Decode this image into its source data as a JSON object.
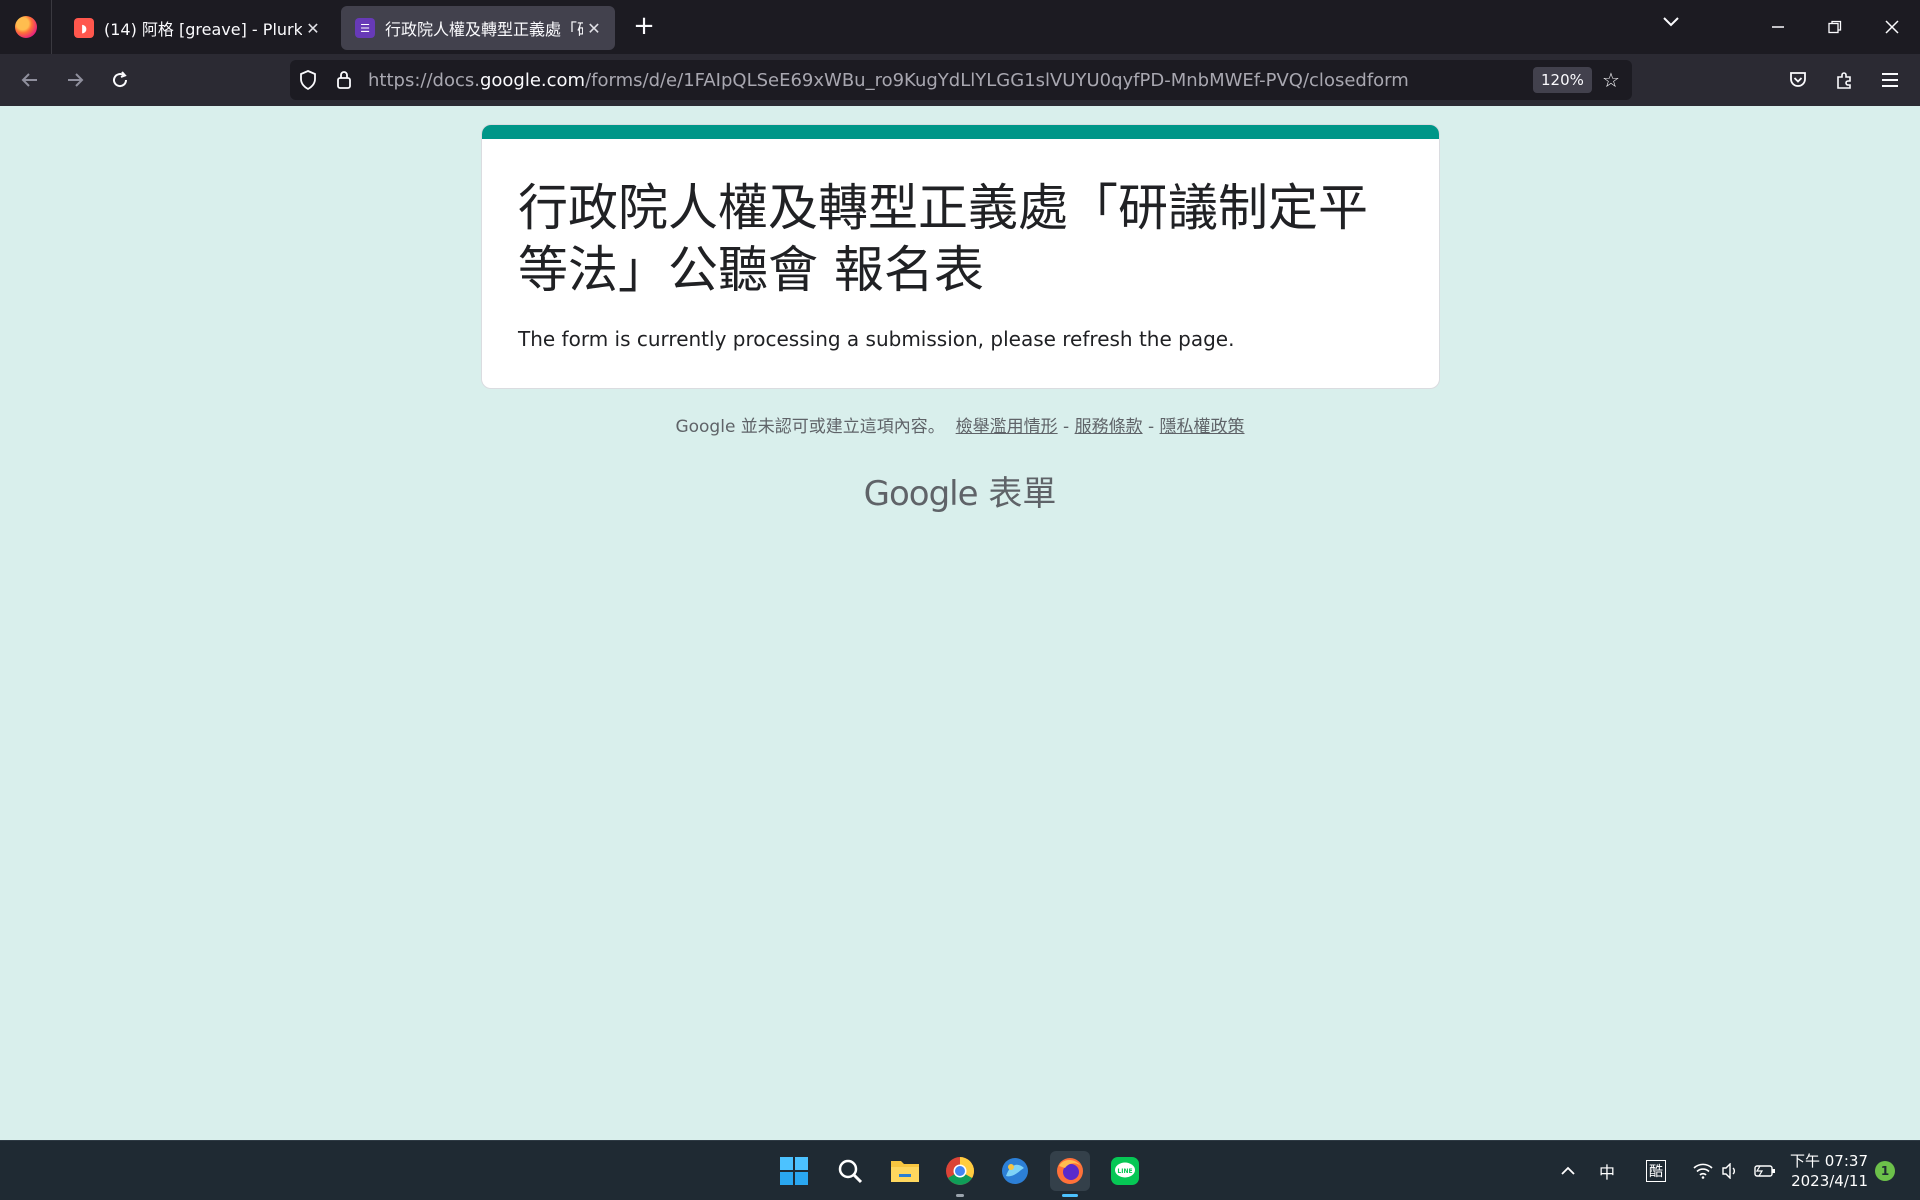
{
  "browser": {
    "tabs": [
      {
        "title": "(14) 阿格 [greave] - Plurk",
        "active": false
      },
      {
        "title": "行政院人權及轉型正義處「研議",
        "active": true
      }
    ],
    "url_prefix": "https://docs.",
    "url_host": "google.com",
    "url_path": "/forms/d/e/1FAIpQLSeE69xWBu_ro9KugYdLlYLGG1slVUYU0qyfPD-MnbMWEf-PVQ/closedform",
    "zoom": "120%"
  },
  "form": {
    "title": "行政院人權及轉型正義處「研議制定平等法」公聽會 報名表",
    "message": "The form is currently processing a submission, please refresh the page.",
    "accent_color": "#009688"
  },
  "footer": {
    "disclaimer": "Google 並未認可或建立這項內容。",
    "links": [
      "檢舉濫用情形",
      "服務條款",
      "隱私權政策"
    ],
    "separator": "-",
    "brand_google": "Google",
    "brand_product": "表單"
  },
  "taskbar": {
    "ime": "中",
    "ime_mode": "酷",
    "clock_time": "下午 07:37",
    "clock_date": "2023/4/11",
    "notification_count": "1"
  }
}
